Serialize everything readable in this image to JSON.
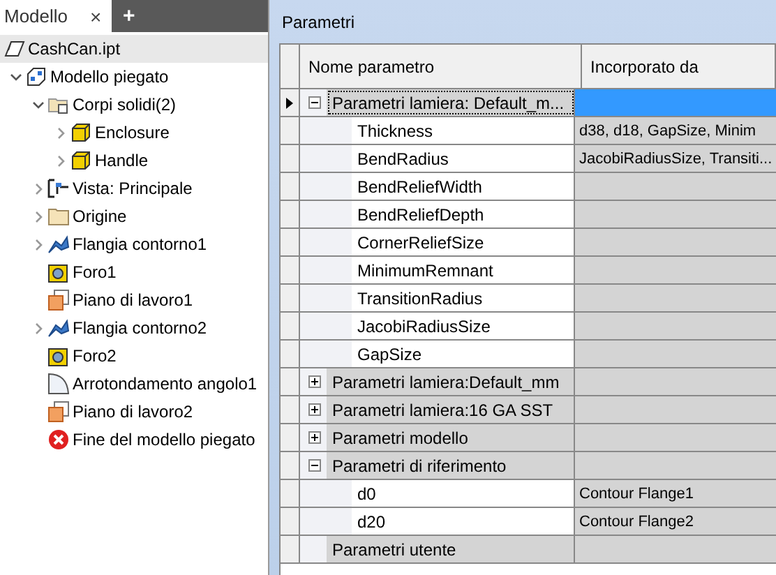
{
  "browser_tabs": [
    {
      "label": "Modello",
      "close": "×",
      "selected": true
    }
  ],
  "add_tab": "+",
  "tree": [
    {
      "label": "CashCan.ipt",
      "kind": "part",
      "selected": true,
      "children": [
        {
          "label": "Modello piegato",
          "kind": "sheetmetal",
          "expanded": true,
          "selected": false,
          "children": [
            {
              "label": "Corpi solidi(2)",
              "kind": "solids",
              "expanded": true,
              "selected": false,
              "children": [
                {
                  "label": "Enclosure",
                  "kind": "solid",
                  "expanded": false,
                  "selected": false
                },
                {
                  "label": "Handle",
                  "kind": "solid",
                  "expanded": false,
                  "selected": false
                }
              ]
            },
            {
              "label": "Vista: Principale",
              "kind": "view",
              "expanded": false,
              "selected": false
            },
            {
              "label": "Origine",
              "kind": "folder",
              "expanded": false,
              "selected": false
            },
            {
              "label": "Flangia contorno1",
              "kind": "flange",
              "expanded": false,
              "selected": false
            },
            {
              "label": "Foro1",
              "kind": "hole",
              "selected": false
            },
            {
              "label": "Piano di lavoro1",
              "kind": "plane",
              "selected": false
            },
            {
              "label": "Flangia contorno2",
              "kind": "flange",
              "expanded": false,
              "selected": false
            },
            {
              "label": "Foro2",
              "kind": "hole",
              "selected": false
            },
            {
              "label": "Arrotondamento angolo1",
              "kind": "fillet",
              "selected": false
            },
            {
              "label": "Piano di lavoro2",
              "kind": "plane",
              "selected": false
            },
            {
              "label": "Fine del modello piegato",
              "kind": "end",
              "selected": false
            }
          ]
        }
      ]
    }
  ],
  "panel": {
    "title": "Parametri"
  },
  "table": {
    "columns": [
      "Nome parametro",
      "Incorporato da"
    ],
    "rows": [
      {
        "kind": "group",
        "name": "Parametri lamiera: Default_m...",
        "expanded": true,
        "selected": true
      },
      {
        "kind": "param",
        "name": "Thickness",
        "used_by": "d38, d18, GapSize, Minim",
        "selected": false
      },
      {
        "kind": "param",
        "name": "BendRadius",
        "used_by": "JacobiRadiusSize, Transiti...",
        "selected": false
      },
      {
        "kind": "param",
        "name": "BendReliefWidth",
        "selected": false
      },
      {
        "kind": "param",
        "name": "BendReliefDepth",
        "selected": false
      },
      {
        "kind": "param",
        "name": "CornerReliefSize",
        "selected": false
      },
      {
        "kind": "param",
        "name": "MinimumRemnant",
        "selected": false
      },
      {
        "kind": "param",
        "name": "TransitionRadius",
        "selected": false
      },
      {
        "kind": "param",
        "name": "JacobiRadiusSize",
        "selected": false
      },
      {
        "kind": "param",
        "name": "GapSize",
        "selected": false
      },
      {
        "kind": "group",
        "name": "Parametri lamiera:Default_mm",
        "expanded": false,
        "selected": false
      },
      {
        "kind": "group",
        "name": "Parametri lamiera:16 GA SST",
        "expanded": false,
        "selected": false
      },
      {
        "kind": "group",
        "name": "Parametri modello",
        "expanded": false,
        "selected": false
      },
      {
        "kind": "group",
        "name": "Parametri di riferimento",
        "expanded": true,
        "selected": false
      },
      {
        "kind": "param",
        "name": "d0",
        "used_by": "Contour Flange1",
        "selected": false
      },
      {
        "kind": "param",
        "name": "d20",
        "used_by": "Contour Flange2",
        "selected": false
      },
      {
        "kind": "group",
        "name": "Parametri utente",
        "selected": false
      }
    ]
  }
}
